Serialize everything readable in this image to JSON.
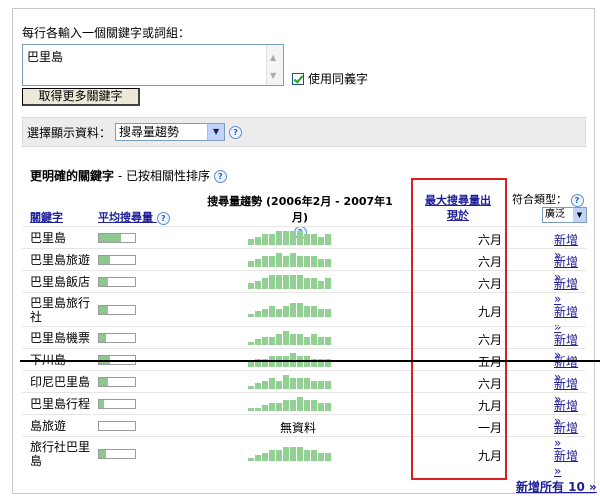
{
  "form": {
    "prompt": "每行各輸入一個關鍵字或詞組：",
    "keyword_value": "巴里島",
    "synonyms_label": "使用同義字",
    "more_button": "取得更多關鍵字"
  },
  "display": {
    "label": "選擇顯示資料：",
    "selected": "搜尋量趨勢"
  },
  "section": {
    "title": "更明確的關鍵字",
    "subtitle": " - 已按相關性排序"
  },
  "headers": {
    "keyword": "關鍵字",
    "avg_volume": "平均搜尋量",
    "trend": "搜尋量趨勢 (2006年2月 - 2007年1月)",
    "peak_line1": "最大搜尋量出",
    "peak_line2": "現於",
    "match_type": "符合類型：",
    "match_selected": "廣泛"
  },
  "rows": [
    {
      "keyword": "巴里島",
      "avg": 0.6,
      "trend": [
        2,
        3,
        4,
        4,
        5,
        5,
        5,
        5,
        4,
        4,
        3,
        4
      ],
      "peak": "六月",
      "add": "新增 »"
    },
    {
      "keyword": "巴里島旅遊",
      "avg": 0.3,
      "trend": [
        2,
        3,
        4,
        4,
        5,
        4,
        5,
        4,
        4,
        4,
        3,
        3
      ],
      "peak": "六月",
      "add": "新增 »"
    },
    {
      "keyword": "巴里島飯店",
      "avg": 0.25,
      "trend": [
        2,
        3,
        4,
        5,
        5,
        5,
        5,
        5,
        4,
        4,
        3,
        4
      ],
      "peak": "六月",
      "add": "新增 »"
    },
    {
      "keyword": "巴里島旅行社",
      "avg": 0.25,
      "trend": [
        1,
        2,
        3,
        4,
        3,
        4,
        5,
        5,
        4,
        4,
        3,
        3
      ],
      "peak": "九月",
      "add": "新增 »"
    },
    {
      "keyword": "巴里島機票",
      "avg": 0.2,
      "trend": [
        1,
        2,
        3,
        3,
        4,
        5,
        4,
        4,
        3,
        4,
        3,
        3
      ],
      "peak": "六月",
      "add": "新增 »"
    },
    {
      "keyword": "下川島",
      "avg": 0.3,
      "trend": [
        2,
        3,
        3,
        4,
        4,
        4,
        5,
        4,
        4,
        3,
        3,
        3
      ],
      "peak": "五月",
      "add": "新增 »"
    },
    {
      "keyword": "印尼巴里島",
      "avg": 0.25,
      "trend": [
        1,
        2,
        3,
        4,
        3,
        5,
        4,
        4,
        4,
        3,
        3,
        3
      ],
      "peak": "六月",
      "add": "新增 »"
    },
    {
      "keyword": "巴里島行程",
      "avg": 0.15,
      "trend": [
        1,
        1,
        2,
        3,
        3,
        4,
        4,
        5,
        4,
        4,
        3,
        3
      ],
      "peak": "九月",
      "add": "新增 »"
    },
    {
      "keyword": "島旅遊",
      "avg": 0.0,
      "trend": [],
      "nodata": "無資料",
      "peak": "一月",
      "add": "新增 »"
    },
    {
      "keyword": "旅行社巴里島",
      "avg": 0.2,
      "trend": [
        1,
        2,
        3,
        4,
        4,
        5,
        5,
        5,
        4,
        4,
        3,
        3
      ],
      "peak": "九月",
      "add": "新增 »"
    }
  ],
  "footer": {
    "add_all": "新增所有 10 »"
  }
}
